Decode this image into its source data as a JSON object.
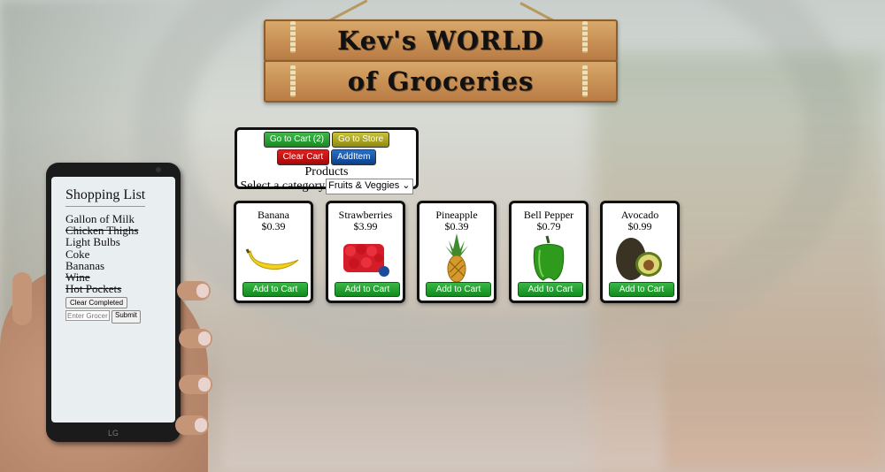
{
  "sign": {
    "line1": "Kev's WORLD",
    "line2": "of Groceries"
  },
  "controls": {
    "go_to_cart": "Go to Cart (2)",
    "go_to_store": "Go to Store",
    "clear_cart": "Clear Cart",
    "add_item": "AddItem",
    "products_label": "Products",
    "category_label": "Select a category",
    "category_selected": "Fruits & Veggies"
  },
  "products": [
    {
      "name": "Banana",
      "price": "$0.39",
      "icon": "banana-icon",
      "button": "Add to Cart"
    },
    {
      "name": "Strawberries",
      "price": "$3.99",
      "icon": "strawberries-icon",
      "button": "Add to Cart"
    },
    {
      "name": "Pineapple",
      "price": "$0.39",
      "icon": "pineapple-icon",
      "button": "Add to Cart"
    },
    {
      "name": "Bell Pepper",
      "price": "$0.79",
      "icon": "bell-pepper-icon",
      "button": "Add to Cart"
    },
    {
      "name": "Avocado",
      "price": "$0.99",
      "icon": "avocado-icon",
      "button": "Add to Cart"
    }
  ],
  "shopping_list": {
    "title": "Shopping List",
    "items": [
      {
        "text": "Gallon of Milk",
        "done": false
      },
      {
        "text": "Chicken Thighs",
        "done": true
      },
      {
        "text": "Light Bulbs",
        "done": false
      },
      {
        "text": "Coke",
        "done": false
      },
      {
        "text": "Bananas",
        "done": false
      },
      {
        "text": "Wine",
        "done": true
      },
      {
        "text": "Hot Pockets",
        "done": true
      }
    ],
    "clear_completed": "Clear Completed",
    "input_placeholder": "Enter Groceries",
    "submit": "Submit",
    "phone_brand": "LG"
  },
  "colors": {
    "add_button": "#1f9a2c",
    "go_to_cart": "#23a12f",
    "go_to_store": "#a8a21e",
    "clear_cart": "#c81010",
    "add_item": "#1452a8"
  }
}
